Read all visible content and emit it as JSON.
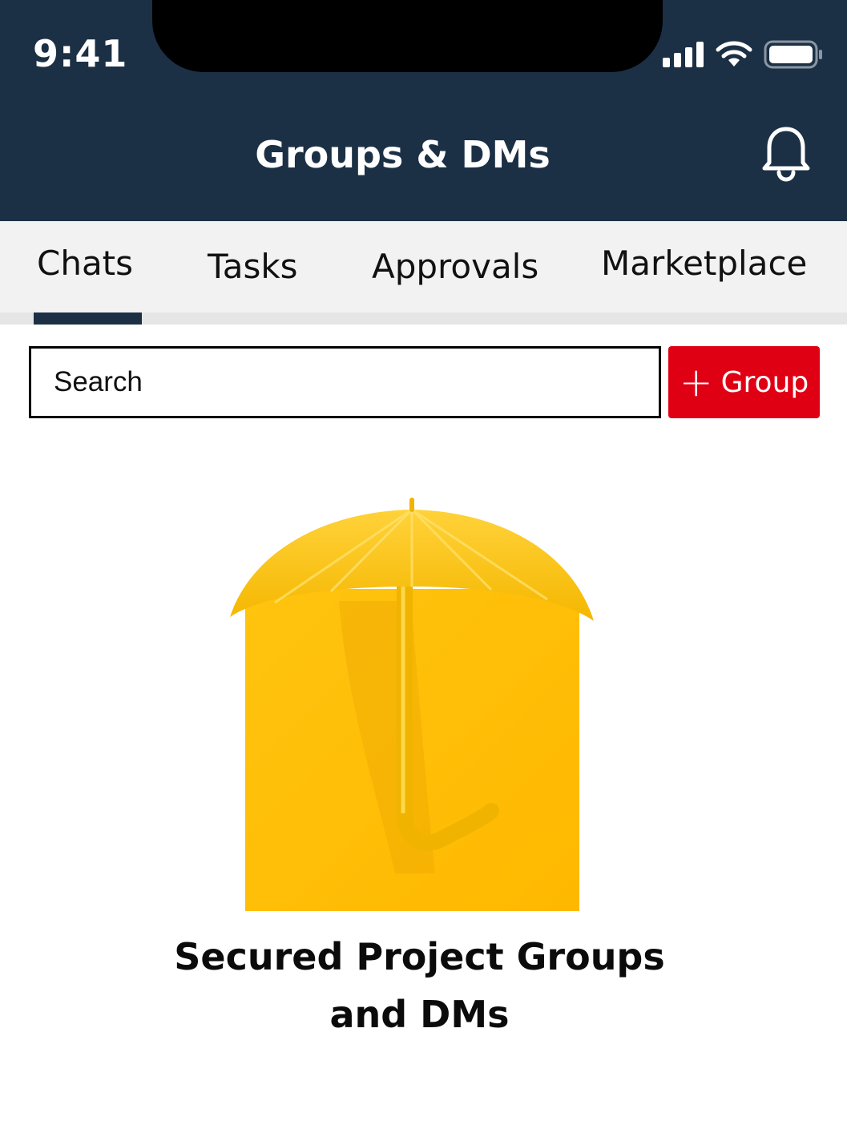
{
  "status_bar": {
    "time": "9:41"
  },
  "header": {
    "title": "Groups & DMs"
  },
  "tabs": [
    {
      "label": "Chats",
      "active": true
    },
    {
      "label": "Tasks",
      "active": false
    },
    {
      "label": "Approvals",
      "active": false
    },
    {
      "label": "Marketplace",
      "active": false
    }
  ],
  "search": {
    "placeholder": "Search"
  },
  "group_button": {
    "icon": "plus-icon",
    "label": "Group"
  },
  "empty_state": {
    "image": "yellow-umbrella",
    "caption_line1": "Secured Project Groups",
    "caption_line2": "and DMs"
  },
  "colors": {
    "header_bg": "#1c3045",
    "accent_red": "#e00014",
    "tab_bg": "#f2f2f2",
    "umbrella_yellow": "#ffc20e"
  }
}
